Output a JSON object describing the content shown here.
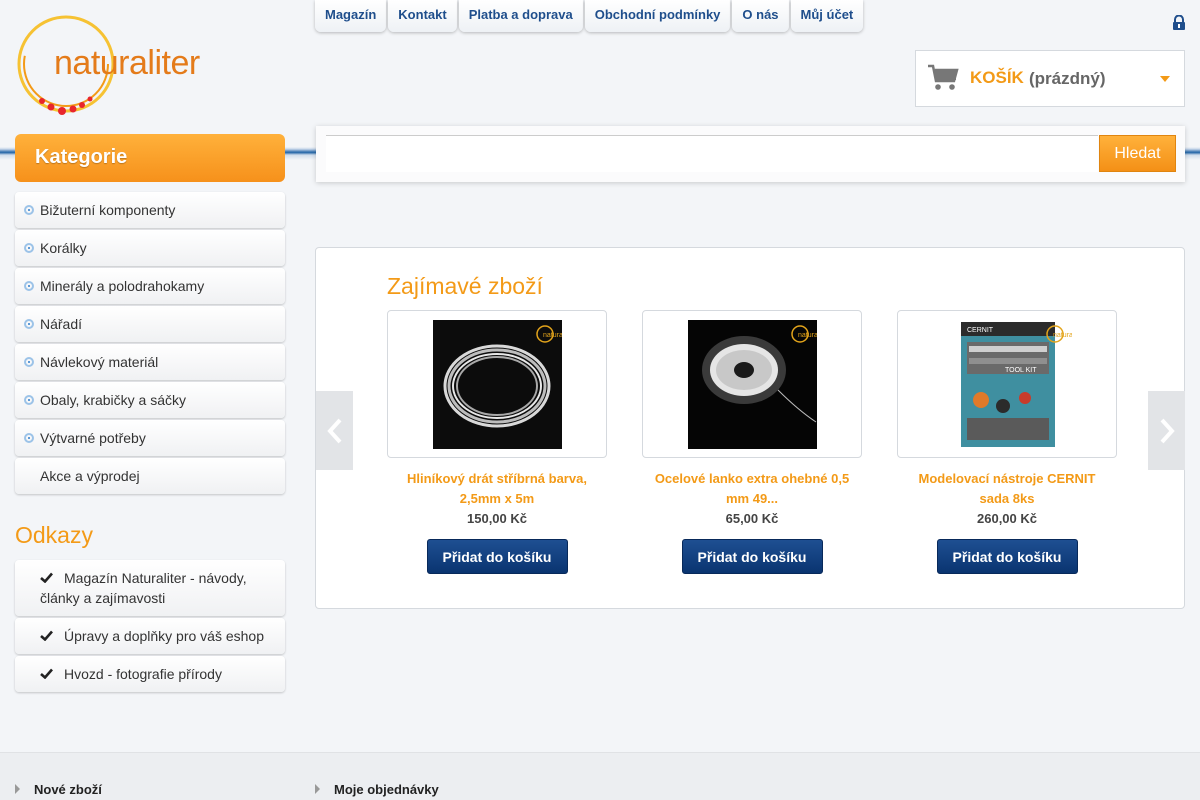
{
  "brand": {
    "logo_text": "naturaliter"
  },
  "top_nav": [
    "Magazín",
    "Kontakt",
    "Platba a doprava",
    "Obchodní podmínky",
    "O nás",
    "Můj účet"
  ],
  "cart": {
    "title": "KOŠÍK",
    "status": "(prázdný)"
  },
  "search": {
    "value": "",
    "placeholder": "",
    "button_label": "Hledat"
  },
  "sidebar": {
    "categories_title": "Kategorie",
    "categories": [
      {
        "label": "Bižuterní komponenty",
        "bullet": true
      },
      {
        "label": "Korálky",
        "bullet": true
      },
      {
        "label": "Minerály a polodrahokamy",
        "bullet": true
      },
      {
        "label": "Nářadí",
        "bullet": true
      },
      {
        "label": "Návlekový materiál",
        "bullet": true
      },
      {
        "label": "Obaly, krabičky a sáčky",
        "bullet": true
      },
      {
        "label": "Výtvarné potřeby",
        "bullet": true
      },
      {
        "label": "Akce a výprodej",
        "bullet": false
      }
    ],
    "links_title": "Odkazy",
    "links": [
      "Magazín Naturaliter - návody, články a zajímavosti",
      "Úpravy a doplňky pro váš eshop",
      "Hvozd - fotografie přírody"
    ]
  },
  "featured": {
    "title": "Zajímavé zboží",
    "products": [
      {
        "name": "Hliníkový drát stříbrná barva, 2,5mm x 5m",
        "price": "150,00 Kč",
        "button": "Přidat do košíku",
        "image": "silver-wire-coil"
      },
      {
        "name": "Ocelové lanko extra ohebné 0,5 mm 49...",
        "price": "65,00 Kč",
        "button": "Přidat do košíku",
        "image": "steel-cable-spool"
      },
      {
        "name": "Modelovací nástroje CERNIT sada 8ks",
        "price": "260,00 Kč",
        "button": "Přidat do košíku",
        "image": "cernit-tool-kit"
      }
    ]
  },
  "footer": {
    "links": [
      "Nové zboží",
      "Moje objednávky"
    ]
  },
  "colors": {
    "accent": "#f39a17",
    "nav_blue": "#1f4e8c",
    "button_blue": "#0a3470"
  }
}
